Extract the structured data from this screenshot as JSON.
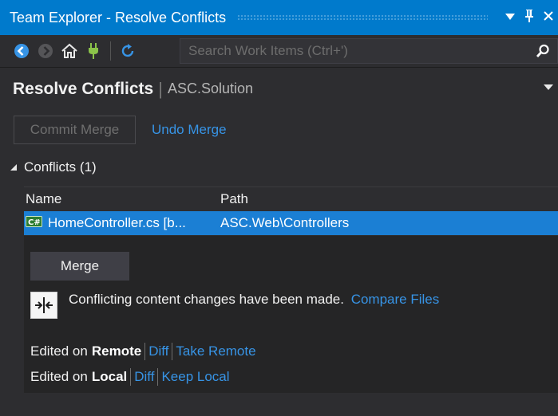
{
  "window": {
    "title": "Team Explorer - Resolve Conflicts",
    "dropdown_icon": "caret-down-icon",
    "pin_icon": "pin-icon",
    "close_icon": "close-icon"
  },
  "toolbar": {
    "icons": [
      "back-icon",
      "forward-icon",
      "home-icon",
      "connect-icon",
      "refresh-icon"
    ],
    "search_placeholder": "Search Work Items (Ctrl+')"
  },
  "header": {
    "title": "Resolve Conflicts",
    "separator": "|",
    "subtitle": "ASC.Solution"
  },
  "actions": {
    "commit_merge": "Commit Merge",
    "undo_merge": "Undo Merge"
  },
  "conflicts": {
    "section_label": "Conflicts (1)",
    "columns": {
      "name": "Name",
      "path": "Path"
    },
    "rows": [
      {
        "name": "HomeController.cs [b...",
        "path": "ASC.Web\\Controllers"
      }
    ]
  },
  "detail": {
    "merge_button": "Merge",
    "message": "Conflicting content changes have been made.",
    "compare_files": "Compare Files",
    "remote": {
      "prefix": "Edited on",
      "label": "Remote",
      "diff": "Diff",
      "take": "Take Remote"
    },
    "local": {
      "prefix": "Edited on",
      "label": "Local",
      "diff": "Diff",
      "keep": "Keep Local"
    }
  },
  "colors": {
    "accent": "#007acc",
    "selection": "#1b7fd4",
    "link": "#3794e6",
    "background": "#2d2d30"
  }
}
